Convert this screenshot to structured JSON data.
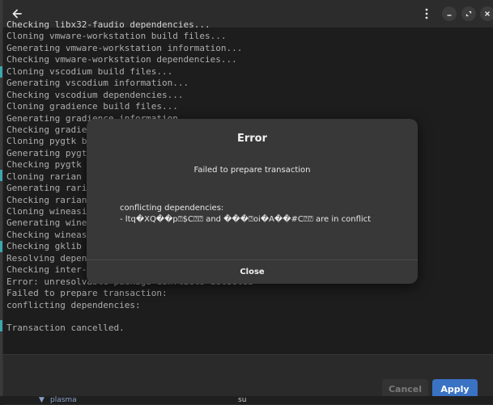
{
  "colors": {
    "window_bg": "#242424",
    "dialog_bg": "#383838",
    "accent": "#3a72c4",
    "edge_mark": "#3ea6ad"
  },
  "headerbar": {
    "back_icon": "arrow-left-icon",
    "menu_icon": "vertical-dots-icon",
    "minimize_icon": "minimize-icon",
    "restore_icon": "restore-icon",
    "close_icon": "close-icon"
  },
  "terminal": {
    "lines": [
      "Checking libx32-faudio dependencies...",
      "Cloning vmware-workstation build files...",
      "Generating vmware-workstation information...",
      "Checking vmware-workstation dependencies...",
      "Cloning vscodium build files...",
      "Generating vscodium information...",
      "Checking vscodium dependencies...",
      "Cloning gradience build files...",
      "Generating gradience information...",
      "Checking gradien",
      "Cloning pygtk bu",
      "Generating pygtk",
      "Checking pygtk d",
      "Cloning rarian b",
      "Generating raria",
      "Checking rarian",
      "Cloning wineasio",
      "Generating winea",
      "Checking wineasi",
      "Checking gklib d",
      "Resolving depend",
      "Checking inter-c",
      "Error: unresolvable package conflicts detected",
      "Failed to prepare transaction:",
      "conflicting dependencies:",
      "",
      "Transaction cancelled."
    ]
  },
  "footer": {
    "cancel_label": "Cancel",
    "apply_label": "Apply"
  },
  "bottom_strip": {
    "item1": "plasma",
    "item2": "su"
  },
  "dialog": {
    "title": "Error",
    "message": "Failed to prepare transaction",
    "detail_line1": "conflicting dependencies:",
    "detail_line2": "- ltq�XQ��p⍰$C⍰⍰ and ���⍰oi�A��#C⍰⍰ are in conflict",
    "close_label": "Close"
  }
}
